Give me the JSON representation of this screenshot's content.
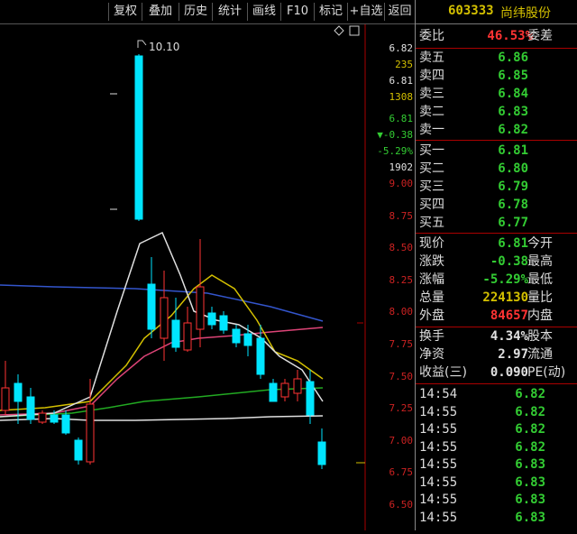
{
  "toolbar": {
    "buttons": [
      "复权",
      "叠加",
      "历史",
      "统计",
      "画线",
      "F10",
      "标记",
      "+自选",
      "返回"
    ]
  },
  "chart": {
    "peak_label": "10.10",
    "top_info": [
      {
        "text": "6.82",
        "color": "#e0e0e0"
      },
      {
        "text": "235",
        "color": "#d4c000"
      },
      {
        "text": "6.81",
        "color": "#e0e0e0"
      },
      {
        "text": "1308",
        "color": "#d4c000"
      },
      {
        "text": "6.81",
        "color": "#33cc33"
      },
      {
        "text": "▼-0.38",
        "color": "#33cc33"
      },
      {
        "text": "-5.29%",
        "color": "#33cc33"
      },
      {
        "text": "1902",
        "color": "#e0e0e0"
      }
    ],
    "price_scale": [
      "9.00",
      "8.75",
      "8.50",
      "8.25",
      "8.00",
      "7.75",
      "7.50",
      "7.25",
      "7.00",
      "6.75",
      "6.50"
    ]
  },
  "header": {
    "code": "603333",
    "name": "尚纬股份"
  },
  "weibi": {
    "label": "委比",
    "value": "46.53%",
    "label2": "委差"
  },
  "sell": [
    {
      "label": "卖五",
      "price": "6.86"
    },
    {
      "label": "卖四",
      "price": "6.85"
    },
    {
      "label": "卖三",
      "price": "6.84"
    },
    {
      "label": "卖二",
      "price": "6.83"
    },
    {
      "label": "卖一",
      "price": "6.82"
    }
  ],
  "buy": [
    {
      "label": "买一",
      "price": "6.81"
    },
    {
      "label": "买二",
      "price": "6.80"
    },
    {
      "label": "买三",
      "price": "6.79"
    },
    {
      "label": "买四",
      "price": "6.78"
    },
    {
      "label": "买五",
      "price": "6.77"
    }
  ],
  "quote": [
    {
      "label": "现价",
      "value": "6.81",
      "color": "#33cc33",
      "label2": "今开"
    },
    {
      "label": "涨跌",
      "value": "-0.38",
      "color": "#33cc33",
      "label2": "最高"
    },
    {
      "label": "涨幅",
      "value": "-5.29%",
      "color": "#33cc33",
      "label2": "最低"
    },
    {
      "label": "总量",
      "value": "224130",
      "color": "#d4c000",
      "label2": "量比"
    },
    {
      "label": "外盘",
      "value": "84657",
      "color": "#ff3333",
      "label2": "内盘"
    }
  ],
  "stats": [
    {
      "label": "换手",
      "value": "4.34%",
      "label2": "股本"
    },
    {
      "label": "净资",
      "value": "2.97",
      "label2": "流通"
    },
    {
      "label": "收益(三)",
      "value": "0.090",
      "label2": "PE(动)"
    }
  ],
  "ticks": [
    {
      "time": "14:54",
      "price": "6.82"
    },
    {
      "time": "14:55",
      "price": "6.82"
    },
    {
      "time": "14:55",
      "price": "6.82"
    },
    {
      "time": "14:55",
      "price": "6.82"
    },
    {
      "time": "14:55",
      "price": "6.83"
    },
    {
      "time": "14:55",
      "price": "6.83"
    },
    {
      "time": "14:55",
      "price": "6.83"
    },
    {
      "time": "14:55",
      "price": "6.83"
    }
  ],
  "colors": {
    "up": "#ff3333",
    "down": "#00e5ff",
    "green": "#33cc33",
    "yellow": "#d4c000"
  }
}
